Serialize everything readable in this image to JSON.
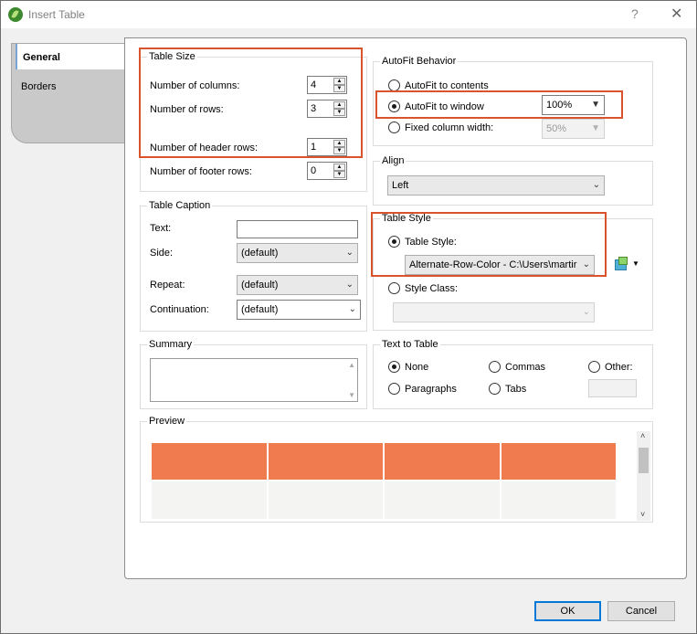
{
  "window": {
    "title": "Insert Table",
    "help_glyph": "?",
    "close_glyph": "✕"
  },
  "tabs": [
    {
      "label": "General"
    },
    {
      "label": "Borders"
    }
  ],
  "table_size": {
    "legend": "Table Size",
    "columns_label": "Number of columns:",
    "columns_value": "4",
    "rows_label": "Number of rows:",
    "rows_value": "3",
    "header_rows_label": "Number of header rows:",
    "header_rows_value": "1",
    "footer_rows_label": "Number of footer rows:",
    "footer_rows_value": "0"
  },
  "autofit": {
    "legend": "AutoFit Behavior",
    "contents_label": "AutoFit to contents",
    "window_label": "AutoFit to window",
    "window_value": "100%",
    "fixed_label": "Fixed column width:",
    "fixed_value": "50%"
  },
  "align": {
    "legend": "Align",
    "value": "Left"
  },
  "caption": {
    "legend": "Table Caption",
    "text_label": "Text:",
    "text_value": "",
    "side_label": "Side:",
    "side_value": "(default)",
    "repeat_label": "Repeat:",
    "repeat_value": "(default)",
    "continuation_label": "Continuation:",
    "continuation_value": "(default)"
  },
  "table_style": {
    "legend": "Table Style",
    "style_label": "Table Style:",
    "style_value": "Alternate-Row-Color - C:\\Users\\martir",
    "class_label": "Style Class:",
    "class_value": ""
  },
  "summary": {
    "legend": "Summary",
    "value": ""
  },
  "text_to_table": {
    "legend": "Text to Table",
    "none_label": "None",
    "commas_label": "Commas",
    "other_label": "Other:",
    "paragraphs_label": "Paragraphs",
    "tabs_label": "Tabs",
    "other_value": ""
  },
  "preview": {
    "legend": "Preview",
    "header_color": "#f07b4f",
    "row_color": "#f4f4f2",
    "columns": 4
  },
  "buttons": {
    "ok": "OK",
    "cancel": "Cancel"
  },
  "colors": {
    "highlight": "#d9532c",
    "accent": "#0078d7"
  }
}
